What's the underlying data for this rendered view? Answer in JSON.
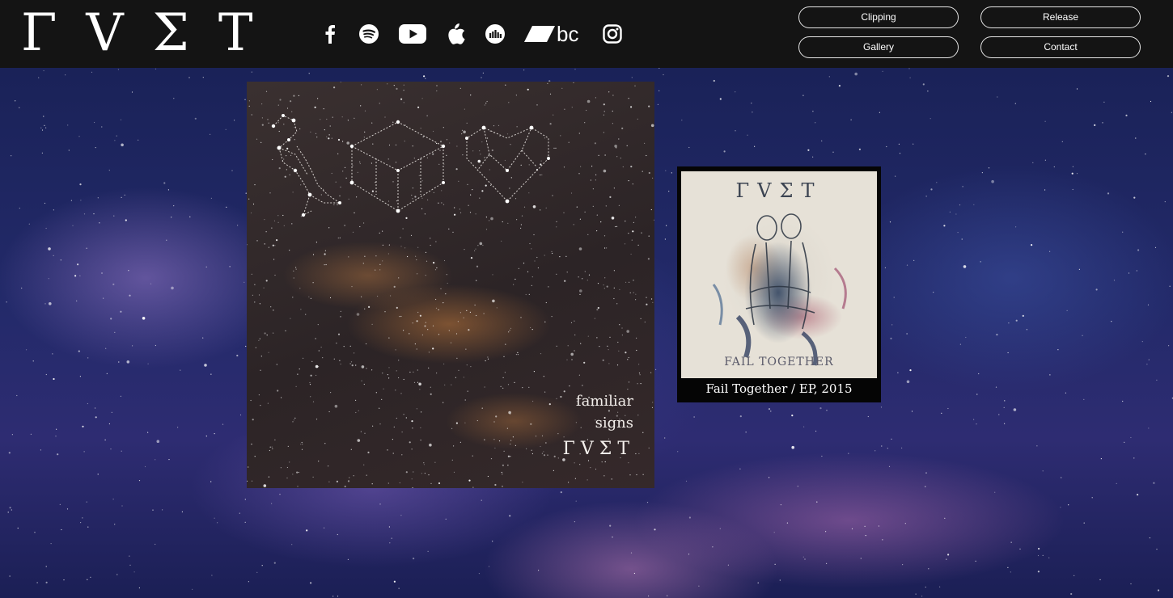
{
  "header": {
    "logo": "ΓVΣT",
    "socials": [
      {
        "name": "facebook-icon"
      },
      {
        "name": "spotify-icon"
      },
      {
        "name": "youtube-icon"
      },
      {
        "name": "apple-icon"
      },
      {
        "name": "deezer-icon"
      },
      {
        "name": "bandcamp-icon",
        "text": "bc"
      },
      {
        "name": "instagram-icon"
      }
    ],
    "nav": {
      "clipping": "Clipping",
      "release": "Release",
      "gallery": "Gallery",
      "contact": "Contact"
    }
  },
  "main": {
    "cover": {
      "title_line1": "familiar",
      "title_line2": "signs",
      "logo": "ΓVΣT"
    },
    "ep": {
      "art_logo": "ΓVΣT",
      "art_caption": "FAIL TOGETHER",
      "label": "Fail Together / EP, 2015"
    }
  },
  "colors": {
    "topbar": "#141414",
    "text": "#ffffff",
    "nav_border": "#e6e6e6"
  }
}
